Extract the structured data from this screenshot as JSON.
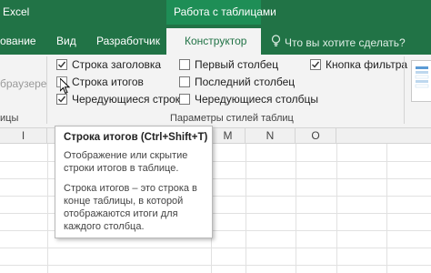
{
  "titlebar": {
    "app_title": "Excel",
    "context_group": "Работа с таблицами"
  },
  "tabs": {
    "review_partial": "ование",
    "view": "Вид",
    "developer": "Разработчик",
    "design_active": "Конструктор",
    "tell_me": "Что вы хотите сделать?"
  },
  "ribbon": {
    "left_partial_1": "браузере",
    "left_partial_2": "ицы",
    "group_caption": "Параметры стилей таблиц",
    "options": [
      {
        "label": "Строка заголовка",
        "checked": true
      },
      {
        "label": "Строка итогов",
        "checked": false
      },
      {
        "label": "Чередующиеся строки",
        "checked": true
      },
      {
        "label": "Первый столбец",
        "checked": false
      },
      {
        "label": "Последний столбец",
        "checked": false
      },
      {
        "label": "Чередующиеся столбцы",
        "checked": false
      },
      {
        "label": "Кнопка фильтра",
        "checked": true
      }
    ]
  },
  "grid": {
    "columns": [
      "I",
      "M",
      "N",
      "O"
    ]
  },
  "tooltip": {
    "title": "Строка итогов (Ctrl+Shift+T)",
    "p1_line1": "Отображение или скрытие",
    "p1_line2": "строки итогов в таблице.",
    "p2_line1": "Строка итогов – это строка в",
    "p2_line2": "конце таблицы, в которой",
    "p2_line3": "отображаются итоги для",
    "p2_line4": "каждого столбца."
  },
  "colors": {
    "excel_green": "#217346",
    "context_green": "#1e8e56",
    "ribbon_bg": "#f3f3f3"
  }
}
